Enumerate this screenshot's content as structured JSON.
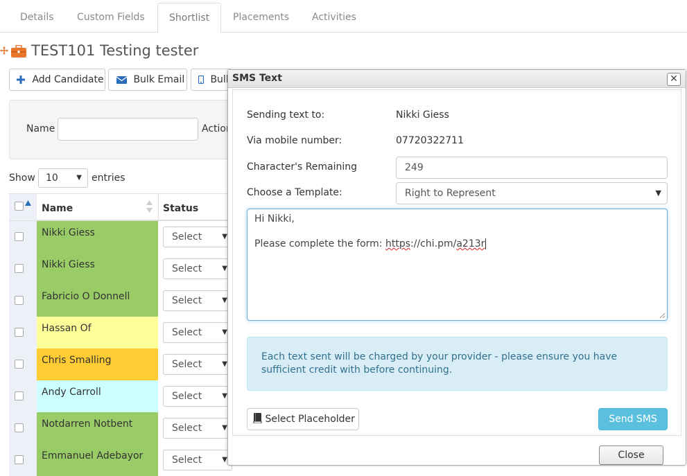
{
  "tabs": [
    {
      "label": "Details"
    },
    {
      "label": "Custom Fields"
    },
    {
      "label": "Shortlist"
    },
    {
      "label": "Placements"
    },
    {
      "label": "Activities"
    }
  ],
  "active_tab": "Shortlist",
  "job": {
    "title": "TEST101 Testing tester"
  },
  "toolbar": {
    "add_candidate": "Add Candidate",
    "bulk_email": "Bulk Email",
    "bulk_sms_partial": "Bulk"
  },
  "filter": {
    "name_label": "Name",
    "name_value": "",
    "action_label_partial": "Action"
  },
  "entries": {
    "show_label": "Show",
    "value": "10",
    "suffix": "entries"
  },
  "table": {
    "headers": {
      "name": "Name",
      "status": "Status"
    },
    "rows": [
      {
        "name": "Nikki Giess",
        "status": "Select",
        "color": "#99cc66"
      },
      {
        "name": "Nikki Giess",
        "status": "Select",
        "color": "#99cc66"
      },
      {
        "name": "Fabricio O Donnell",
        "status": "Select",
        "color": "#99cc66"
      },
      {
        "name": "Hassan Of",
        "status": "Select",
        "color": "#ffff99"
      },
      {
        "name": "Chris Smalling",
        "status": "Select",
        "color": "#ffcc33"
      },
      {
        "name": "Andy Carroll",
        "status": "Select",
        "color": "#ccffff"
      },
      {
        "name": "Notdarren Notbent",
        "status": "Select",
        "color": "#99cc66"
      },
      {
        "name": "Emmanuel Adebayor",
        "status": "Select",
        "color": "#99cc66"
      }
    ]
  },
  "modal": {
    "title": "SMS Text",
    "close_glyph": "✕",
    "sending_to_label": "Sending text to:",
    "sending_to_value": "Nikki Giess",
    "mobile_label": "Via mobile number:",
    "mobile_value": "07720322711",
    "remaining_label": "Character's Remaining",
    "remaining_value": "249",
    "template_label": "Choose a Template:",
    "template_value": "Right to Represent",
    "message_line1": "Hi Nikki,",
    "message_line2_prefix": "Please complete the form: ",
    "message_link_a": "https",
    "message_link_b": "://chi.pm/",
    "message_link_c": "a213r",
    "alert_text": "Each text sent will be charged by your provider - please ensure you have sufficient credit with before continuing.",
    "placeholder_button": "Select Placeholder",
    "send_button": "Send SMS",
    "close_button": "Close"
  },
  "colors": {
    "accent_blue": "#2a6ebb",
    "briefcase_orange": "#e8762c",
    "send_button": "#5bc0de",
    "alert_bg": "#d9edf7"
  }
}
